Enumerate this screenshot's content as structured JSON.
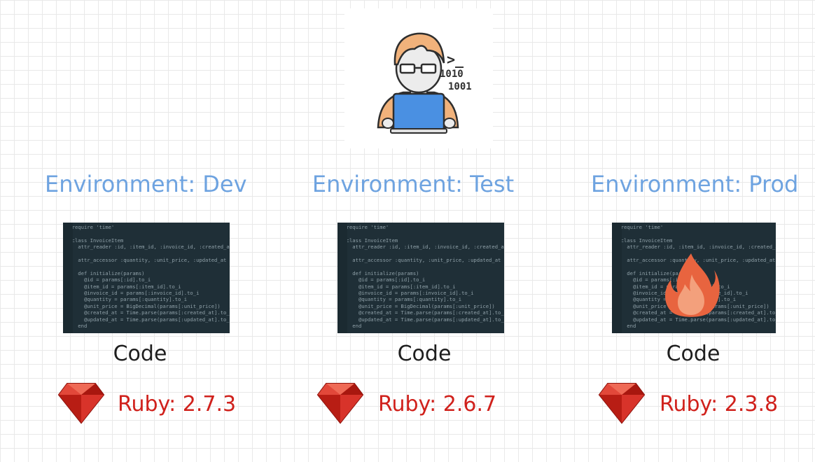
{
  "environments": [
    {
      "title": "Environment: Dev",
      "code_label": "Code",
      "ruby_version": "Ruby: 2.7.3",
      "on_fire": false
    },
    {
      "title": "Environment: Test",
      "code_label": "Code",
      "ruby_version": "Ruby: 2.6.7",
      "on_fire": false
    },
    {
      "title": "Environment: Prod",
      "code_label": "Code",
      "ruby_version": "Ruby: 2.3.8",
      "on_fire": true
    }
  ],
  "developer_icon": {
    "name": "developer-at-laptop-icon",
    "terminal_prompt": ">_",
    "binary_line_1": "1010",
    "binary_line_2": "1001"
  },
  "icons": {
    "ruby": "ruby-gem-icon",
    "fire": "fire-icon"
  },
  "colors": {
    "env_title": "#6ea3e0",
    "ruby_text": "#d0211c",
    "code_label": "#1e1e1e",
    "code_background": "#1f2f37",
    "fire_outer": "#e8643f",
    "fire_inner": "#f3a07c"
  },
  "code_snippet": "  require 'time'\n\n  class InvoiceItem\n    attr_reader :id, :item_id, :invoice_id, :created_at\n\n    attr_accessor :quantity, :unit_price, :updated_at\n\n    def initialize(params)\n      @id = params[:id].to_i\n      @item_id = params[:item_id].to_i\n      @invoice_id = params[:invoice_id].to_i\n      @quantity = params[:quantity].to_i\n      @unit_price = BigDecimal(params[:unit_price])\n      @created_at = Time.parse(params[:created_at].to_s)\n      @updated_at = Time.parse(params[:updated_at].to_s)\n    end\n\n    def unit_price_to_dollars\n      @unit_price.to_f\n    end\n  end"
}
